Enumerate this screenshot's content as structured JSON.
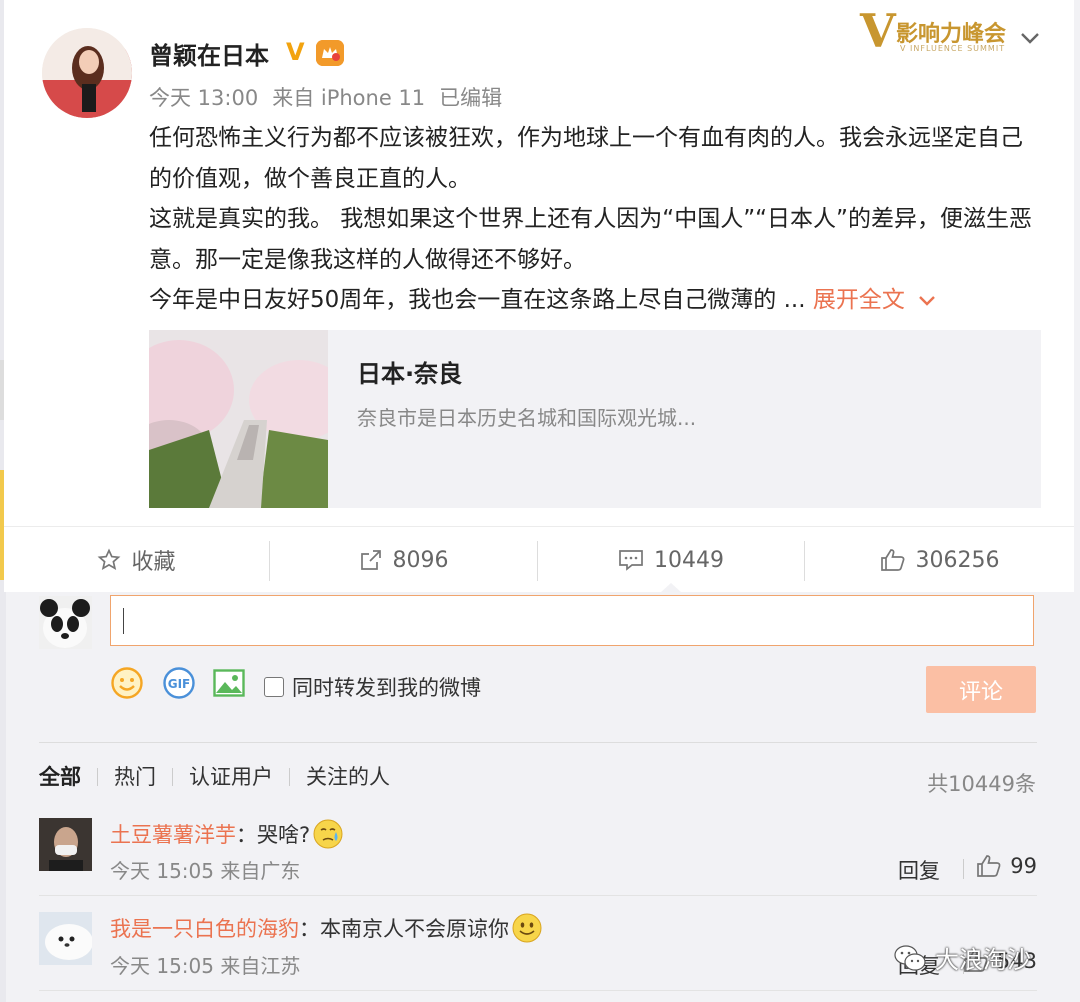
{
  "post": {
    "username": "曾颖在日本",
    "verified_badge": "V",
    "member_badge": "会员",
    "timestamp": "今天 13:00",
    "source": "来自 iPhone 11",
    "edited": "已编辑",
    "paragraphs": [
      "任何恐怖主义行为都不应该被狂欢，作为地球上一个有血有肉的人。我会永远坚定自己的价值观，做个善良正直的人。",
      "这就是真实的我。 我想如果这个世界上还有人因为“中国人”“日本人”的差异，便滋生恶意。那一定是像我这样的人做得还不够好。"
    ],
    "last_line": "今年是中日友好50周年，我也会一直在这条路上尽自己微薄的 ...",
    "expand_label": "展开全文",
    "link_card": {
      "title": "日本·奈良",
      "description": "奈良市是日本历史名城和国际观光城..."
    }
  },
  "branding": {
    "logo_letter": "V",
    "logo_text": "影响力峰会",
    "logo_subtext": "V INFLUENCE SUMMIT"
  },
  "actions": {
    "favorite_label": "收藏",
    "repost_count": "8096",
    "comment_count": "10449",
    "like_count": "306256"
  },
  "composer": {
    "placeholder": "",
    "repost_checkbox_label": "同时转发到我的微博",
    "submit_label": "评论",
    "gif_label": "GIF"
  },
  "filters": {
    "tabs": [
      "全部",
      "热门",
      "认证用户",
      "关注的人"
    ],
    "total": "共10449条"
  },
  "comments": [
    {
      "user": "土豆薯薯洋芋",
      "text": "：哭啥?",
      "time": "今天 15:05 来自广东",
      "reply_label": "回复",
      "likes": "99"
    },
    {
      "user": "我是一只白色的海豹",
      "text": "：本南京人不会原谅你",
      "time": "今天 15:05 来自江苏",
      "reply_label": "回复",
      "likes": "543"
    }
  ],
  "watermark": "大浪淘沙",
  "colors": {
    "accent": "#eb7350",
    "verified": "#f2a30f",
    "submit_disabled": "#fbbfa4",
    "brand_gold": "#c8962f"
  },
  "icons": [
    "star-icon",
    "repost-icon",
    "comment-icon",
    "like-icon",
    "emoji-icon",
    "gif-icon",
    "image-icon",
    "chevron-down-icon",
    "wechat-icon"
  ]
}
